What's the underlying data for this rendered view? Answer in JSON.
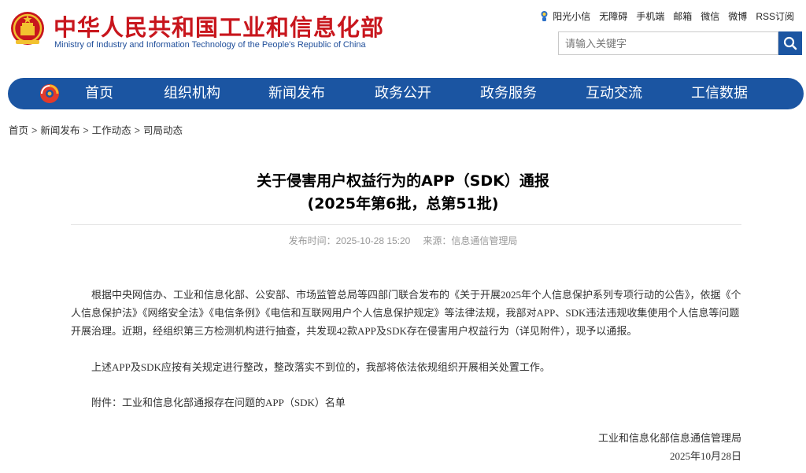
{
  "header": {
    "site_title": "中华人民共和国工业和信息化部",
    "site_subtitle": "Ministry of Industry and Information Technology of the People's Republic of China",
    "top_links": [
      "阳光小信",
      "无障碍",
      "手机端",
      "邮箱",
      "微信",
      "微博",
      "RSS订阅"
    ],
    "search_placeholder": "请输入关键字"
  },
  "nav": {
    "items": [
      "首页",
      "组织机构",
      "新闻发布",
      "政务公开",
      "政务服务",
      "互动交流",
      "工信数据"
    ]
  },
  "breadcrumb": [
    "首页",
    "新闻发布",
    "工作动态",
    "司局动态"
  ],
  "breadcrumb_sep": ">",
  "article": {
    "title_line1": "关于侵害用户权益行为的APP（SDK）通报",
    "title_line2": "(2025年第6批，总第51批)",
    "publish_label": "发布时间：",
    "publish_time": "2025-10-28 15:20",
    "source_label": "来源：",
    "source": "信息通信管理局",
    "paragraphs": [
      "根据中央网信办、工业和信息化部、公安部、市场监管总局等四部门联合发布的《关于开展2025年个人信息保护系列专项行动的公告》，依据《个人信息保护法》《网络安全法》《电信条例》《电信和互联网用户个人信息保护规定》等法律法规，我部对APP、SDK违法违规收集使用个人信息等问题开展治理。近期，经组织第三方检测机构进行抽查，共发现42款APP及SDK存在侵害用户权益行为（详见附件），现予以通报。",
      "上述APP及SDK应按有关规定进行整改，整改落实不到位的，我部将依法依规组织开展相关处置工作。"
    ],
    "attachment_label": "附件：",
    "attachment": "工业和信息化部通报存在问题的APP（SDK）名单",
    "signature_org": "工业和信息化部信息通信管理局",
    "signature_date": "2025年10月28日"
  },
  "colors": {
    "brand_red": "#c8161d",
    "nav_blue": "#1b55a2",
    "subtitle_blue": "#1f4e9a",
    "meta_gray": "#999999"
  },
  "icons": [
    "national-emblem-icon",
    "sunshine-icon",
    "search-icon",
    "nav-logo-icon"
  ]
}
